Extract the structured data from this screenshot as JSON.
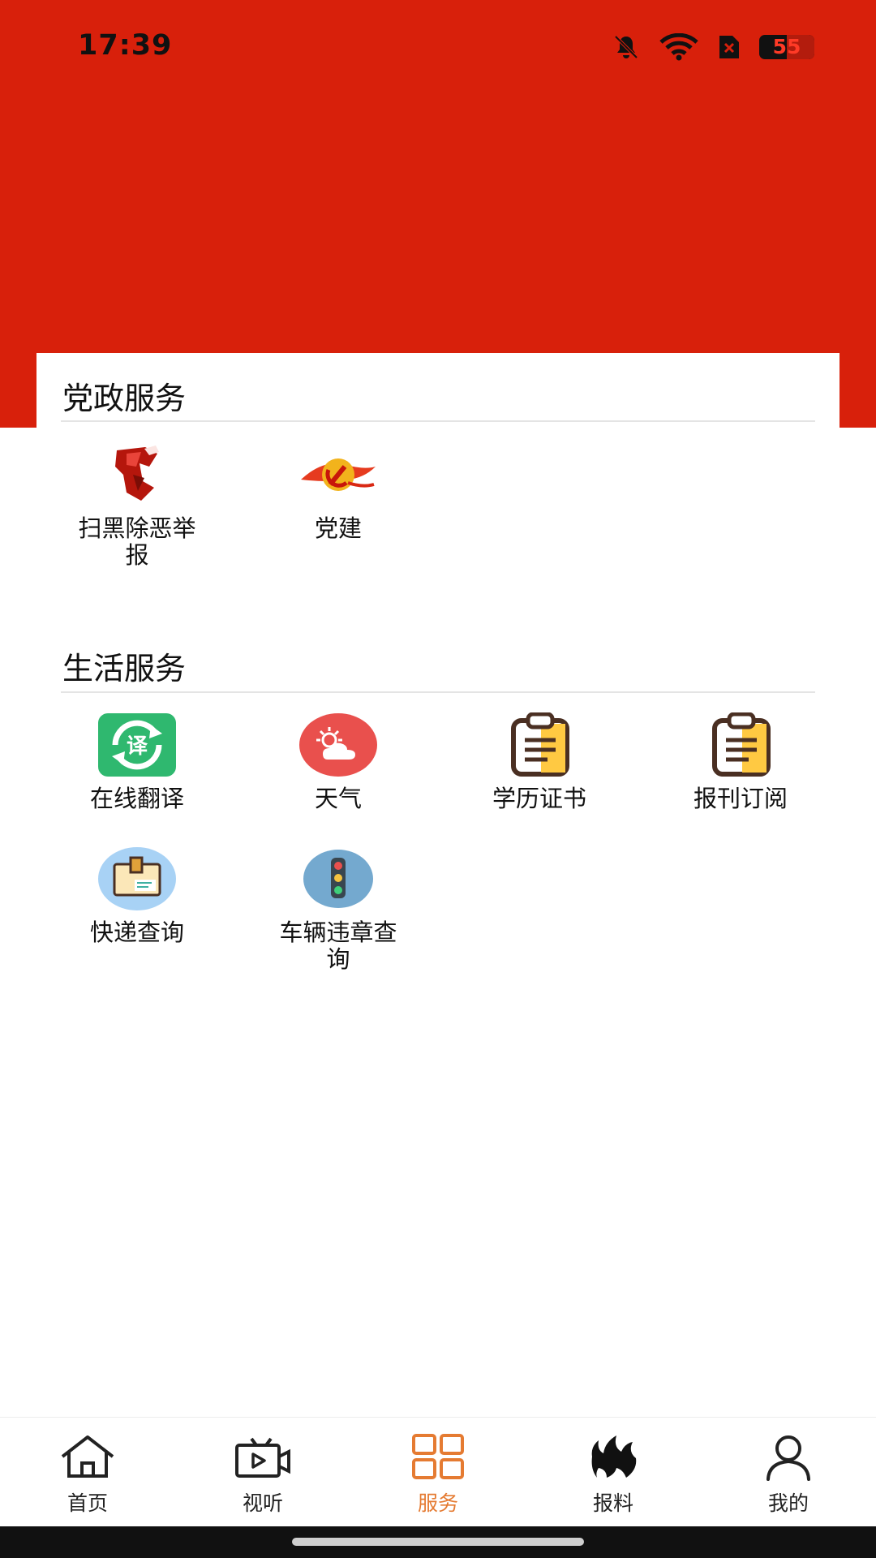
{
  "status_bar": {
    "time": "17:39",
    "battery": "55",
    "icons": [
      "bell-off-icon",
      "wifi-icon",
      "sim-x-icon",
      "battery-icon"
    ]
  },
  "sections": [
    {
      "title": "党政服务",
      "items": [
        {
          "label": "扫黑除恶举报",
          "icon": "anti-crime-icon"
        },
        {
          "label": "党建",
          "icon": "party-emblem-icon"
        }
      ]
    },
    {
      "title": "生活服务",
      "items": [
        {
          "label": "在线翻译",
          "icon": "translate-icon"
        },
        {
          "label": "天气",
          "icon": "weather-icon"
        },
        {
          "label": "学历证书",
          "icon": "clipboard-icon"
        },
        {
          "label": "报刊订阅",
          "icon": "clipboard-icon"
        },
        {
          "label": "快递查询",
          "icon": "package-icon"
        },
        {
          "label": "车辆违章查询",
          "icon": "traffic-light-icon"
        }
      ]
    }
  ],
  "bottom_nav": [
    {
      "label": "首页",
      "icon": "home-icon"
    },
    {
      "label": "视听",
      "icon": "tv-icon"
    },
    {
      "label": "服务",
      "icon": "grid-icon",
      "active": true
    },
    {
      "label": "报料",
      "icon": "flame-icon"
    },
    {
      "label": "我的",
      "icon": "user-icon"
    }
  ],
  "colors": {
    "header_red": "#d8200b",
    "active_orange": "#e57b32"
  }
}
